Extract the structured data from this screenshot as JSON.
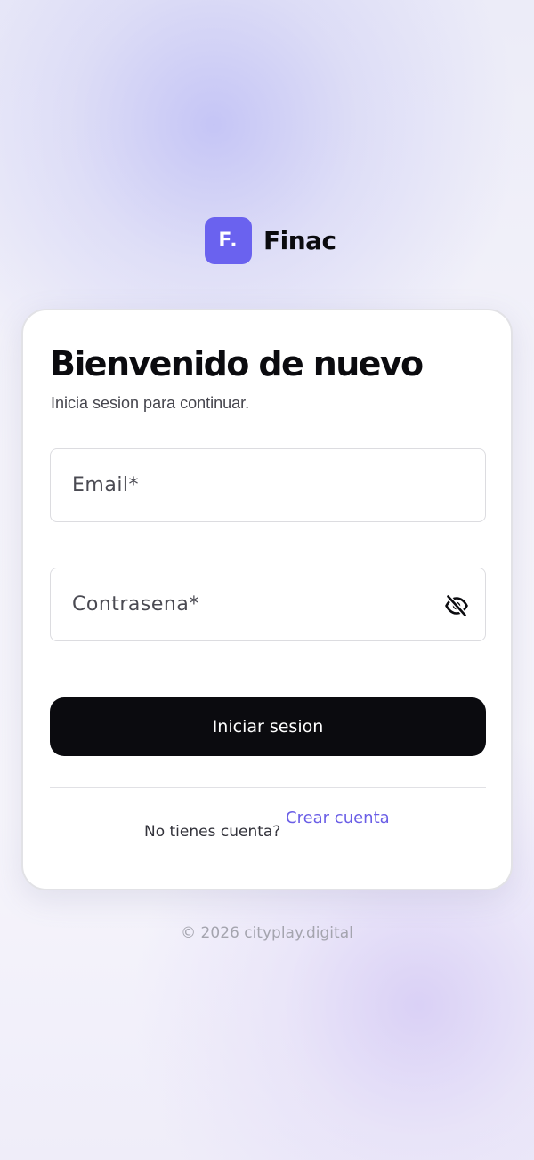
{
  "brand": {
    "logo_text": "F.",
    "name": "Finac",
    "accent_color": "#6a62ef"
  },
  "login": {
    "title": "Bienvenido de nuevo",
    "subtitle": "Inicia sesion para continuar.",
    "email_placeholder": "Email*",
    "password_placeholder": "Contrasena*",
    "password_toggle_icon": "eye-off-icon",
    "submit_label": "Iniciar sesion",
    "no_account_text": "No tienes cuenta?",
    "create_account_label": "Crear cuenta",
    "link_color": "#6a5ee6"
  },
  "footer": {
    "copyright": "© 2026 cityplay.digital"
  }
}
